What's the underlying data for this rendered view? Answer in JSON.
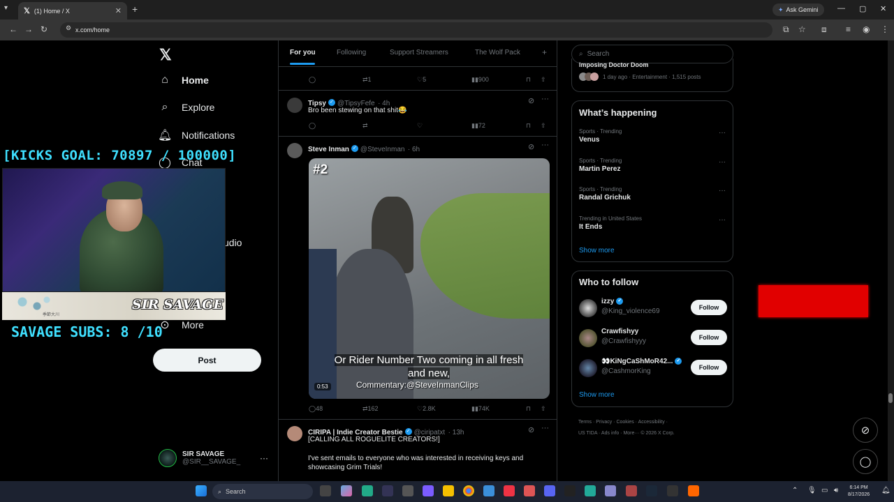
{
  "browser": {
    "tab_title": "(1) Home / X",
    "tab_logo": "𝕏",
    "tab_close": "✕",
    "new_tab": "+",
    "gemini_label": "Ask Gemini",
    "url": "x.com/home",
    "window_controls": {
      "minimize": "—",
      "maximize": "▢",
      "close": "✕"
    }
  },
  "nav": {
    "logo": "𝕏",
    "items": [
      {
        "label": "Home",
        "icon": "home-icon"
      },
      {
        "label": "Explore",
        "icon": "search-icon"
      },
      {
        "label": "Notifications",
        "icon": "bell-icon"
      },
      {
        "label": "Chat",
        "icon": "chat-icon"
      },
      {
        "label": "udio",
        "icon": ""
      },
      {
        "label": "More",
        "icon": "more-icon"
      }
    ],
    "post_button": "Post",
    "account": {
      "name": "SIR SAVAGE",
      "handle": "@SIR__SAVAGE_"
    },
    "account_more": "···"
  },
  "overlay": {
    "kicks_goal": "[KICKS GOAL: 70897 / 100000]",
    "streamer_banner": "SIR SAVAGE",
    "banner_small_text": "季節大川",
    "subs": "SAVAGE SUBS: 8 /10"
  },
  "feed": {
    "tabs": [
      "For you",
      "Following",
      "Support Streamers",
      "The Wolf Pack"
    ],
    "add_tab": "+",
    "top_actions": {
      "replies": "",
      "reposts": "1",
      "likes": "5",
      "views": "900"
    },
    "tweets": [
      {
        "name": "Tipsy",
        "handle": "@TipsyFefe",
        "time": "· 4h",
        "text": "Bro been stewing on that shit😂",
        "replies": "",
        "reposts": "",
        "likes": "",
        "views": "72"
      },
      {
        "name": "Steve Inman",
        "handle": "@SteveInman",
        "time": "· 6h",
        "video": {
          "number": "#2",
          "caption_line1": "Or Rider Number Two coming in all fresh",
          "caption_line2": "and new,",
          "credit": "Commentary:@SteveInmanClips",
          "duration": "0:53"
        },
        "replies": "48",
        "reposts": "162",
        "likes": "2.8K",
        "views": "74K"
      },
      {
        "name": "CIRIPA | Indie Creator Bestie",
        "handle": "@ciripatxt",
        "time": "· 13h",
        "text": "[CALLING ALL ROGUELITE CREATORS!]",
        "text2": "I've sent emails to everyone who was interested in receiving keys and",
        "text3": "showcasing Grim Trials!"
      }
    ]
  },
  "sidebar": {
    "search_placeholder": "Search",
    "top_card": {
      "title": "Imposing Doctor Doom",
      "meta": "1 day ago · Entertainment · 1,515 posts"
    },
    "whats_happening": {
      "title": "What’s happening",
      "trends": [
        {
          "category": "Sports · Trending",
          "title": "Venus"
        },
        {
          "category": "Sports · Trending",
          "title": "Martin Perez"
        },
        {
          "category": "Sports · Trending",
          "title": "Randal Grichuk"
        },
        {
          "category": "Trending in United States",
          "title": "It Ends"
        }
      ],
      "show_more": "Show more"
    },
    "who_to_follow": {
      "title": "Who to follow",
      "accounts": [
        {
          "name": "izzy",
          "handle": "@King_violence69",
          "verified": true
        },
        {
          "name": "Crawfishyy",
          "handle": "@Crawfishyyy",
          "verified": false
        },
        {
          "name": "👀KiNgCaShMoR42...",
          "handle": "@CashmorKing",
          "verified": true
        }
      ],
      "follow_label": "Follow",
      "show_more": "Show more"
    },
    "footer": {
      "line1": "Terms · Privacy · Cookies · Accessibility ·",
      "line2": "US TIDA · Ads info · More··· © 2026 X Corp."
    }
  },
  "taskbar": {
    "search_label": "Search",
    "time": "6:14 PM",
    "date": "8/17/2026"
  },
  "colors": {
    "accent": "#1d9bf0",
    "overlay_text": "#3fe0ff",
    "red_box": "#e10000"
  }
}
